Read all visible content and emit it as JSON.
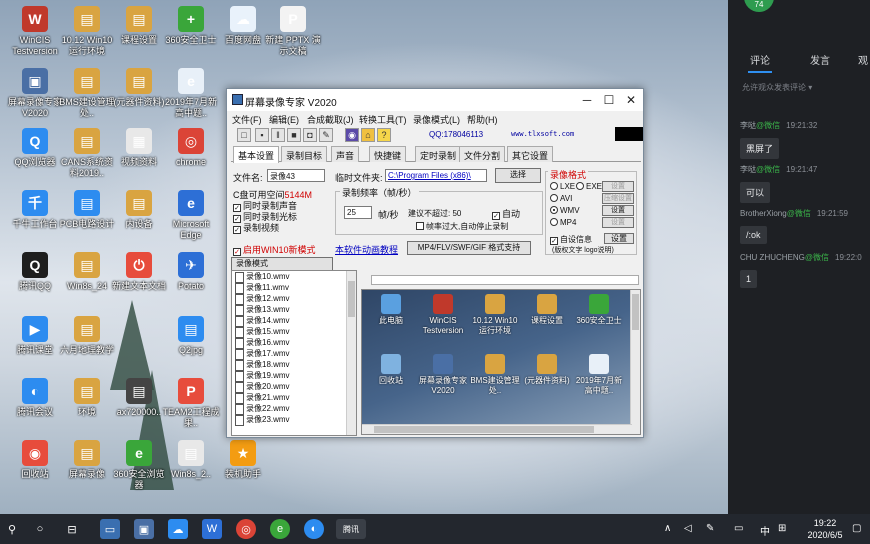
{
  "desktop": {
    "icons": [
      {
        "label": "WinCIS Testversion",
        "color": "#c0392b",
        "glyph": "W"
      },
      {
        "label": "10.12 Win10 运行环境",
        "color": "#d9a441",
        "glyph": "▤"
      },
      {
        "label": "课程设置",
        "color": "#d9a441",
        "glyph": "▤"
      },
      {
        "label": "360安全卫士",
        "color": "#3aa63a",
        "glyph": "+"
      },
      {
        "label": "百度网盘",
        "color": "#e9f2fb",
        "glyph": "☁"
      },
      {
        "label": "新建 PPTX 演示文稿",
        "color": "#f3f3f3",
        "glyph": "P"
      },
      {
        "label": "屏幕录像专家V2020",
        "color": "#4a6fa5",
        "glyph": "▣"
      },
      {
        "label": "BMS建设管理处..",
        "color": "#d9a441",
        "glyph": "▤"
      },
      {
        "label": "(元器件资料)",
        "color": "#d9a441",
        "glyph": "▤"
      },
      {
        "label": "2019年7月新高中题..",
        "color": "#e8f0f8",
        "glyph": "e"
      },
      {
        "label": "QQ浏览器",
        "color": "#2d8cf0",
        "glyph": "Q"
      },
      {
        "label": "CANS系统资料2019..",
        "color": "#d9a441",
        "glyph": "▤"
      },
      {
        "label": "视频资料",
        "color": "#e8e8e8",
        "glyph": "▦"
      },
      {
        "label": "chrome",
        "color": "#db4437",
        "glyph": "◎"
      },
      {
        "label": "千牛工作台",
        "color": "#2d8cf0",
        "glyph": "千"
      },
      {
        "label": "PCB电路设计",
        "color": "#2d8cf0",
        "glyph": "▤"
      },
      {
        "label": "内设备",
        "color": "#d9a441",
        "glyph": "▤"
      },
      {
        "label": "Microsoft Edge",
        "color": "#2d6fd6",
        "glyph": "e"
      },
      {
        "label": "腾讯QQ",
        "color": "#1e1e1e",
        "glyph": "Q"
      },
      {
        "label": "Win8s_24",
        "color": "#d9a441",
        "glyph": "▤"
      },
      {
        "label": "新建文本文档",
        "color": "#e74c3c",
        "glyph": "⏻"
      },
      {
        "label": "Potato",
        "color": "#2d6fd6",
        "glyph": "✈"
      },
      {
        "label": "腾讯课堂",
        "color": "#2d8cf0",
        "glyph": "▶"
      },
      {
        "label": "六月地理教学",
        "color": "#d9a441",
        "glyph": "▤"
      },
      {
        "label": "Q2jpg",
        "color": "#2d8cf0",
        "glyph": "▤"
      },
      {
        "label": "腾讯会议",
        "color": "#2d8cf0",
        "glyph": "◐"
      },
      {
        "label": "环境",
        "color": "#d9a441",
        "glyph": "▤"
      },
      {
        "label": "ax720000..",
        "color": "#444",
        "glyph": "▤"
      },
      {
        "label": "TEAM2工程成果..",
        "color": "#e74c3c",
        "glyph": "P"
      },
      {
        "label": "回收站",
        "color": "#e74c3c",
        "glyph": "◉"
      },
      {
        "label": "屏幕录像",
        "color": "#d9a441",
        "glyph": "▤"
      },
      {
        "label": "360安全浏览器",
        "color": "#3aa63a",
        "glyph": "e"
      },
      {
        "label": "Win8s_2..",
        "color": "#e8e8e8",
        "glyph": "▤"
      },
      {
        "label": "装机助手",
        "color": "#f39c12",
        "glyph": "★"
      }
    ]
  },
  "window": {
    "title": "屏幕录像专家 V2020",
    "menus": [
      "文件(F)",
      "编辑(E)",
      "合成截取(J)",
      "转换工具(T)",
      "录像模式(L)",
      "帮助(H)"
    ],
    "qq": "QQ:178046113",
    "site": "www.tlxsoft.com",
    "tabs": [
      "基本设置",
      "录制目标",
      "声音",
      "快捷键",
      "定时录制",
      "文件分割",
      "其它设置"
    ],
    "filename_label": "文件名:",
    "filename_value": "录像43",
    "tempfolder_label": "临时文件夹:",
    "tempfolder_value": "C:\\Program Files (x86)\\",
    "select_button": "选择",
    "disk_space_label": "C盘可用空间",
    "disk_space_value": "5144M",
    "checks": [
      "同时录制声音",
      "同时录制光标",
      "录制视频"
    ],
    "framerate_group": "录制频率（帧/秒）",
    "framerate_value": "25",
    "framerate_unit": "帧/秒",
    "framerate_hint": "建议不超过: 50",
    "auto_label": "自动",
    "drop_hint": "帧率过大,自动停止录制",
    "win10_mode": "启用WIN10新模式",
    "tutorial_link": "本软件动画教程",
    "format_support_button": "MP4/FLV/SWF/GIF 格式支持",
    "format_group": "录像格式",
    "formats": [
      {
        "name": "LXE",
        "exe": "EXE",
        "btn": "设置",
        "selected": false,
        "disabled": true
      },
      {
        "name": "AVI",
        "btn": "压缩设置",
        "selected": false,
        "disabled": true
      },
      {
        "name": "WMV",
        "btn": "设置",
        "selected": true,
        "disabled": false
      },
      {
        "name": "MP4",
        "btn": "设置",
        "selected": false,
        "disabled": true
      }
    ],
    "auto_info": "自设信息",
    "auto_info_btn": "设置",
    "auto_info_note": "(版权文字 logo说明)",
    "mode_tab": "录像模式",
    "files": [
      "录像10.wmv",
      "录像11.wmv",
      "录像12.wmv",
      "录像13.wmv",
      "录像14.wmv",
      "录像15.wmv",
      "录像16.wmv",
      "录像17.wmv",
      "录像18.wmv",
      "录像19.wmv",
      "录像20.wmv",
      "录像21.wmv",
      "录像22.wmv",
      "录像23.wmv"
    ],
    "preview_icons": [
      {
        "label": "此电脑",
        "color": "#5aa0e0"
      },
      {
        "label": "WinCIS Testversion",
        "color": "#c0392b"
      },
      {
        "label": "10.12 Win10 运行环境",
        "color": "#d9a441"
      },
      {
        "label": "课程设置",
        "color": "#d9a441"
      },
      {
        "label": "360安全卫士",
        "color": "#3aa63a"
      },
      {
        "label": "回收站",
        "color": "#7fb2e0"
      },
      {
        "label": "屏幕录像专家V2020",
        "color": "#4a6fa5"
      },
      {
        "label": "BMS建设管理处..",
        "color": "#d9a441"
      },
      {
        "label": "(元器件资料)",
        "color": "#d9a441"
      },
      {
        "label": "2019年7月新高中题..",
        "color": "#e8f0f8"
      }
    ]
  },
  "panel": {
    "avatar_text": "74",
    "tabs": [
      "评论",
      "发言",
      "观"
    ],
    "hint": "允许观众发表评论",
    "comments": [
      {
        "user": "李哒",
        "wx": "@微信",
        "time": "19:21:32",
        "text": "黑屏了"
      },
      {
        "user": "李哒",
        "wx": "@微信",
        "time": "19:21:47",
        "text": "可以"
      },
      {
        "user": "BrotherXiong",
        "wx": "@微信",
        "time": "19:21:59",
        "text": "/:ok"
      },
      {
        "user": "CHU ZHUCHENG",
        "wx": "@微信",
        "time": "19:22:0",
        "text": "1"
      }
    ]
  },
  "taskbar": {
    "active_label": "腾讯",
    "ime": "中",
    "time": "19:22",
    "date": "2020/6/5"
  }
}
